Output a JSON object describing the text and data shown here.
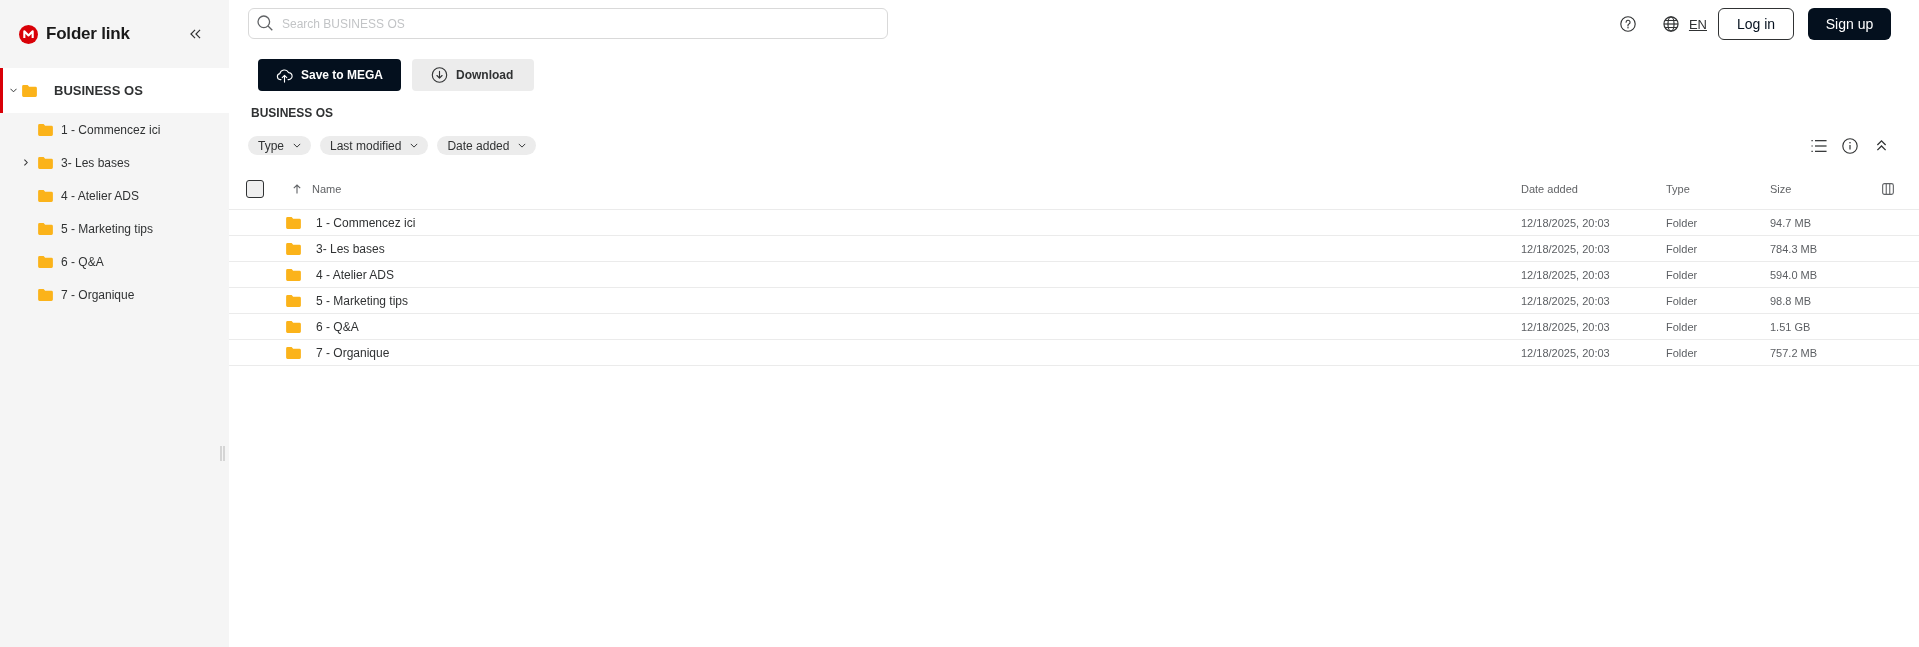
{
  "sidebar": {
    "title": "Folder link",
    "tree": [
      {
        "label": "BUSINESS OS",
        "selected": true,
        "expanded": true,
        "children": [
          {
            "label": "1 - Commencez ici",
            "selected": false,
            "expandable": false
          },
          {
            "label": "3- Les bases",
            "selected": false,
            "expandable": true
          },
          {
            "label": "4 - Atelier ADS",
            "selected": false,
            "expandable": false
          },
          {
            "label": "5 - Marketing tips",
            "selected": false,
            "expandable": false
          },
          {
            "label": "6 - Q&A",
            "selected": false,
            "expandable": false
          },
          {
            "label": "7 - Organique",
            "selected": false,
            "expandable": false
          }
        ]
      }
    ]
  },
  "top_bar": {
    "search": {
      "placeholder": "Search BUSINESS OS"
    },
    "language": "EN",
    "buttons": [
      {
        "label": "Log in",
        "kind": "outline"
      },
      {
        "label": "Sign up",
        "kind": "filled"
      }
    ]
  },
  "actions": [
    {
      "label": "Save to MEGA",
      "kind": "save"
    },
    {
      "label": "Download",
      "kind": "download"
    }
  ],
  "breadcrumb": "BUSINESS OS",
  "filters": [
    {
      "label": "Type"
    },
    {
      "label": "Last modified"
    },
    {
      "label": "Date added"
    }
  ],
  "table": {
    "select_all": {
      "checked": false
    },
    "columns": [
      {
        "label": "Name",
        "sorted": true
      },
      {
        "label": "Date added",
        "sorted": false
      },
      {
        "label": "Type",
        "sorted": false
      },
      {
        "label": "Size",
        "sorted": false
      }
    ],
    "rows": [
      {
        "name": "1 - Commencez ici",
        "date_added": "12/18/2025, 20:03",
        "type": "Folder",
        "size": "94.7 MB"
      },
      {
        "name": "3- Les bases",
        "date_added": "12/18/2025, 20:03",
        "type": "Folder",
        "size": "784.3 MB"
      },
      {
        "name": "4 - Atelier ADS",
        "date_added": "12/18/2025, 20:03",
        "type": "Folder",
        "size": "594.0 MB"
      },
      {
        "name": "5 - Marketing tips",
        "date_added": "12/18/2025, 20:03",
        "type": "Folder",
        "size": "98.8 MB"
      },
      {
        "name": "6 - Q&A",
        "date_added": "12/18/2025, 20:03",
        "type": "Folder",
        "size": "1.51 GB"
      },
      {
        "name": "7 - Organique",
        "date_added": "12/18/2025, 20:03",
        "type": "Folder",
        "size": "757.2 MB"
      }
    ]
  }
}
